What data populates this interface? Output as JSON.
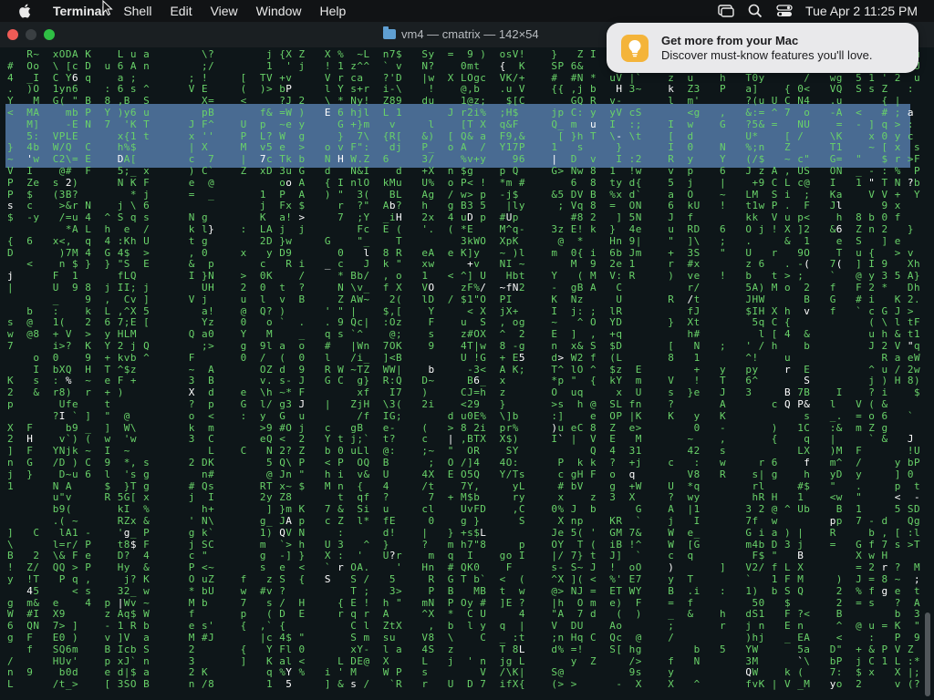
{
  "menubar": {
    "app_name": "Terminal",
    "items": [
      "Shell",
      "Edit",
      "View",
      "Window",
      "Help"
    ],
    "clock": "Tue Apr 2  11:25 PM"
  },
  "window": {
    "title": "vm4 — cmatrix — 142×54"
  },
  "notification": {
    "title": "Get more from your Mac",
    "body": "Discover must-know features you'll love."
  },
  "matrix": {
    "glyphs": "0123456789ABCDEFGHIJKLMNOPQRSTUVWXYZabcdefghijklmnopqrstuvwxyz!@#$%^&*()_+-=[]{};:'\"<>?/|\\~`,.",
    "colors": {
      "green": "#69d269",
      "white": "#ffffff",
      "background": "#0e1619",
      "selection": "#5a84b5"
    }
  }
}
